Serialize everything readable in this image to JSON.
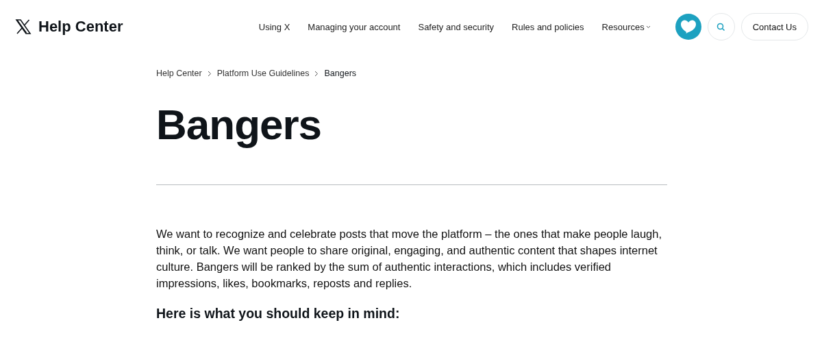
{
  "header": {
    "logo_text": "Help Center",
    "nav": [
      {
        "label": "Using X",
        "has_menu": false
      },
      {
        "label": "Managing your account",
        "has_menu": false
      },
      {
        "label": "Safety and security",
        "has_menu": false
      },
      {
        "label": "Rules and policies",
        "has_menu": false
      },
      {
        "label": "Resources",
        "has_menu": true
      }
    ],
    "contact_button": "Contact Us"
  },
  "breadcrumb": [
    {
      "label": "Help Center",
      "current": false
    },
    {
      "label": "Platform Use Guidelines",
      "current": false
    },
    {
      "label": "Bangers",
      "current": true
    }
  ],
  "title": "Bangers",
  "body": "We want to recognize and celebrate posts that move the platform – the ones that make people laugh, think, or talk. We want people to share original, engaging, and authentic content that shapes internet culture. Bangers will be ranked by the sum of authentic interactions, which includes verified impressions, likes, bookmarks, reposts and replies.",
  "subheading": "Here is what you should keep in mind:"
}
